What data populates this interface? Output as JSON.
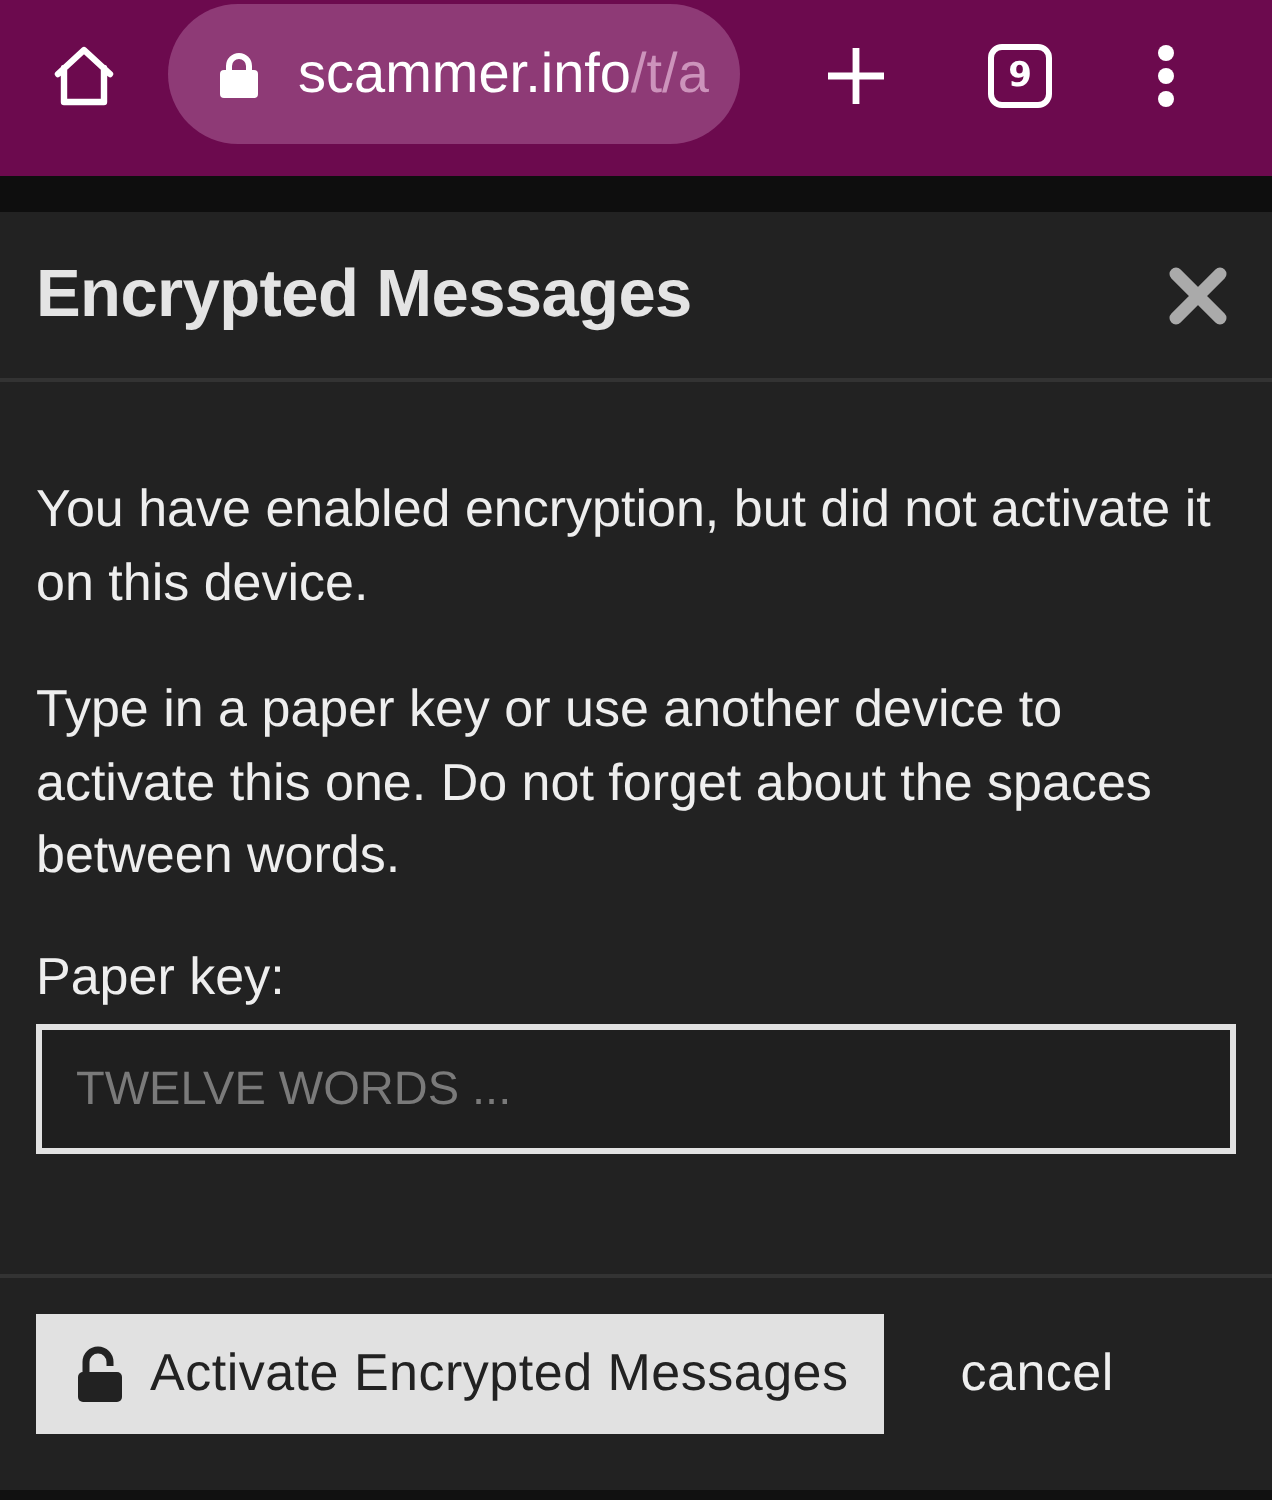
{
  "browser_bar": {
    "url": {
      "host": "scammer.info",
      "path": "/t/a"
    },
    "tab_count": "9"
  },
  "dialog": {
    "title": "Encrypted Messages",
    "paragraphs": [
      "You have enabled encryption, but did not activate it on this device.",
      "Type in a paper key or use another device to activate this one. Do not forget about the spaces between words."
    ],
    "field": {
      "label": "Paper key:",
      "placeholder": "TWELVE WORDS ..."
    },
    "buttons": [
      {
        "kind": "primary",
        "label": "Activate Encrypted Messages"
      },
      {
        "kind": "link",
        "label": "cancel"
      }
    ]
  }
}
